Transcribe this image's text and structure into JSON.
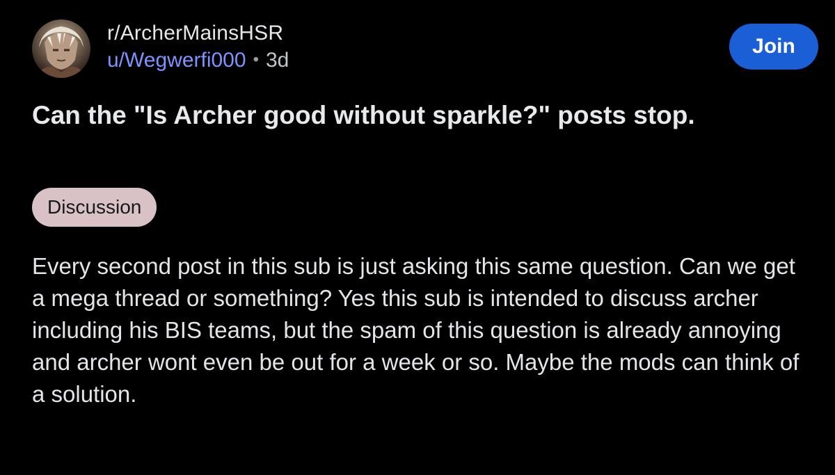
{
  "post": {
    "subreddit": "r/ArcherMainsHSR",
    "username": "u/Wegwerfi000",
    "separator": "•",
    "age": "3d",
    "join_label": "Join",
    "title": "Can the \"Is Archer good without sparkle?\" posts stop.",
    "flair": "Discussion",
    "body": "Every second post in this sub is just asking this same question. Can we get a mega thread or something? Yes this sub is intended to discuss archer including his BIS teams, but the spam of this question is already annoying and archer wont even be out for a week or so. Maybe the mods can think of a solution."
  },
  "colors": {
    "background": "#000000",
    "username": "#7e93ff",
    "join_button": "#1b5fd6",
    "flair_bg": "#d9c2c6"
  },
  "icons": {
    "avatar": "subreddit-avatar"
  }
}
